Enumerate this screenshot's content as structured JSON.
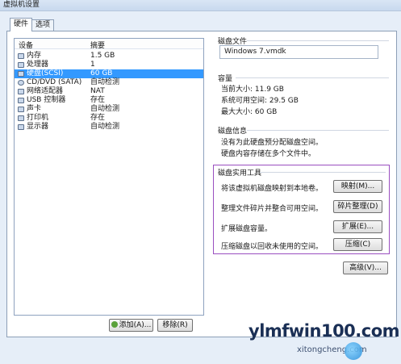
{
  "window": {
    "title": "虚拟机设置"
  },
  "tabs": [
    {
      "label": "硬件"
    },
    {
      "label": "选项"
    }
  ],
  "devices": {
    "col_device": "设备",
    "col_summary": "摘要",
    "rows": [
      {
        "name": "内存",
        "summary": "1.5 GB",
        "icon": "memory-icon"
      },
      {
        "name": "处理器",
        "summary": "1",
        "icon": "cpu-icon"
      },
      {
        "name": "硬盘(SCSI)",
        "summary": "60 GB",
        "icon": "hard-disk-icon",
        "selected": true
      },
      {
        "name": "CD/DVD (SATA)",
        "summary": "自动检测",
        "icon": "cd-dvd-icon"
      },
      {
        "name": "网络适配器",
        "summary": "NAT",
        "icon": "network-adapter-icon"
      },
      {
        "name": "USB 控制器",
        "summary": "存在",
        "icon": "usb-icon"
      },
      {
        "name": "声卡",
        "summary": "自动检测",
        "icon": "sound-card-icon"
      },
      {
        "name": "打印机",
        "summary": "存在",
        "icon": "printer-icon"
      },
      {
        "name": "显示器",
        "summary": "自动检测",
        "icon": "display-icon"
      }
    ],
    "add_label": "添加(A)...",
    "remove_label": "移除(R)"
  },
  "disk_file": {
    "title": "磁盘文件",
    "value": "Windows 7.vmdk"
  },
  "capacity": {
    "title": "容量",
    "current": "当前大小: 11.9 GB",
    "available": "系统可用空间: 29.5 GB",
    "maximum": "最大大小: 60 GB"
  },
  "disk_info": {
    "title": "磁盘信息",
    "line1": "没有为此硬盘预分配磁盘空间。",
    "line2": "硬盘内容存储在多个文件中。"
  },
  "utilities": {
    "title": "磁盘实用工具",
    "map_desc": "将该虚拟机磁盘映射到本地卷。",
    "map_button": "映射(M)...",
    "defrag_desc": "整理文件碎片并整合可用空间。",
    "defrag_button": "碎片整理(D)",
    "expand_desc": "扩展磁盘容量。",
    "expand_button": "扩展(E)...",
    "compact_desc": "压缩磁盘以回收未使用的空间。",
    "compact_button": "压缩(C)"
  },
  "advanced_button": "高级(V)...",
  "watermark": {
    "text": "ylmfwin100.com",
    "sub": "xitongcheng.com"
  }
}
